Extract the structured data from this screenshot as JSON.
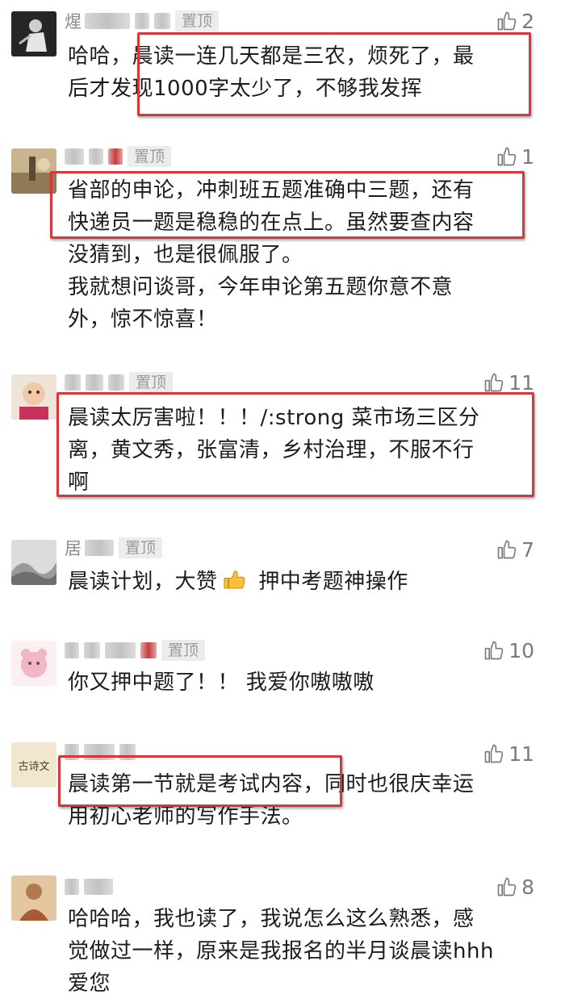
{
  "comments": [
    {
      "name": "煋",
      "pin": "置顶",
      "likes": "2",
      "lines": [
        "哈哈，晨读一连几天都是三农，烦死了，最",
        "后才发现1000字太少了，不够我发挥"
      ]
    },
    {
      "name": "",
      "pin": "置顶",
      "likes": "1",
      "lines": [
        "省部的申论，冲刺班五题准确中三题，还有",
        "快递员一题是稳稳的在点上。虽然要查内容",
        "没猜到，也是很佩服了。",
        "我就想问谈哥，今年申论第五题你意不意",
        "外，惊不惊喜！"
      ]
    },
    {
      "name": "",
      "pin": "置顶",
      "likes": "11",
      "lines": [
        "晨读太厉害啦！！！/:strong 菜市场三区分",
        "离，黄文秀，张富清，乡村治理，不服不行",
        "啊"
      ]
    },
    {
      "name": "居",
      "pin": "置顶",
      "likes": "7",
      "line_a": "晨读计划，大赞",
      "line_b": " 押中考题神操作"
    },
    {
      "name": "",
      "pin": "置顶",
      "likes": "10",
      "lines": [
        "你又押中题了！！ 我爱你嗷嗷嗷"
      ]
    },
    {
      "name": "",
      "likes": "11",
      "lines": [
        "晨读第一节就是考试内容，同时也很庆幸运",
        "用初心老师的写作手法。"
      ],
      "avatar_text": "古诗文"
    },
    {
      "name": "",
      "likes": "8",
      "lines": [
        "哈哈哈，我也读了，我说怎么这么熟悉，感",
        "觉做过一样，原来是我报名的半月谈晨读hhh",
        "爱您"
      ]
    }
  ],
  "icons": {
    "like": "thumbs-up-outline-icon",
    "emoji": "thumbs-up-emoji-icon"
  },
  "colors": {
    "highlight_box": "#d6373a",
    "meta_gray": "#8a8a8a"
  }
}
